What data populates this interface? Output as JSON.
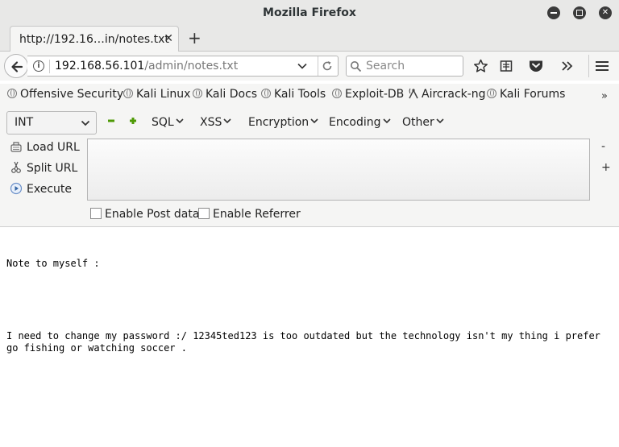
{
  "window": {
    "title": "Mozilla Firefox"
  },
  "tab": {
    "label": "http://192.16…in/notes.txt"
  },
  "urlbar": {
    "host": "192.168.56.101",
    "path": "/admin/notes.txt"
  },
  "search": {
    "placeholder": "Search"
  },
  "bookmarks": [
    {
      "label": "Offensive Security"
    },
    {
      "label": "Kali Linux"
    },
    {
      "label": "Kali Docs"
    },
    {
      "label": "Kali Tools"
    },
    {
      "label": "Exploit-DB"
    },
    {
      "label": "Aircrack-ng"
    },
    {
      "label": "Kali Forums"
    }
  ],
  "hackbar": {
    "type_select": "INT",
    "menus": [
      "SQL",
      "XSS",
      "Encryption",
      "Encoding",
      "Other"
    ],
    "actions": {
      "load": "Load URL",
      "split": "Split URL",
      "execute": "Execute"
    },
    "side": {
      "minus": "-",
      "plus": "+"
    },
    "checkboxes": {
      "post": "Enable Post data",
      "referrer": "Enable Referrer"
    }
  },
  "page": {
    "line1": "Note to myself :",
    "line2": "I need to change my password :/ 12345ted123 is too outdated but the technology isn't my thing i prefer go fishing or watching soccer ."
  },
  "colors": {
    "accent_green": "#4e9a06",
    "chrome_bg": "#f5f5f4",
    "titlebar_bg": "#e8e8e7"
  }
}
